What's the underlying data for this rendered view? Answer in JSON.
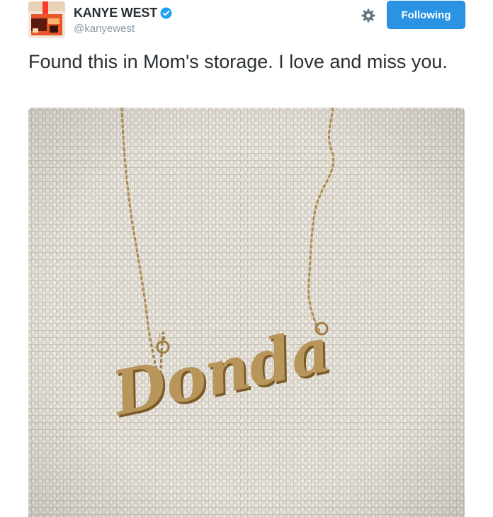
{
  "tweet": {
    "author": {
      "display_name": "KANYE WEST",
      "handle": "@kanyewest",
      "verified": true,
      "avatar_icon": "avatar-image"
    },
    "actions": {
      "settings_icon": "gear-icon",
      "follow_label": "Following"
    },
    "text": "Found this in Mom's storage.  I love and miss you.",
    "media": {
      "necklace_text": "Donda"
    }
  },
  "colors": {
    "follow_button": "#2b93e3",
    "verified_badge": "#1da1f2",
    "handle": "#8899a6",
    "text": "#292f33",
    "linen": "#dedad2",
    "gold": "#a8864a"
  }
}
